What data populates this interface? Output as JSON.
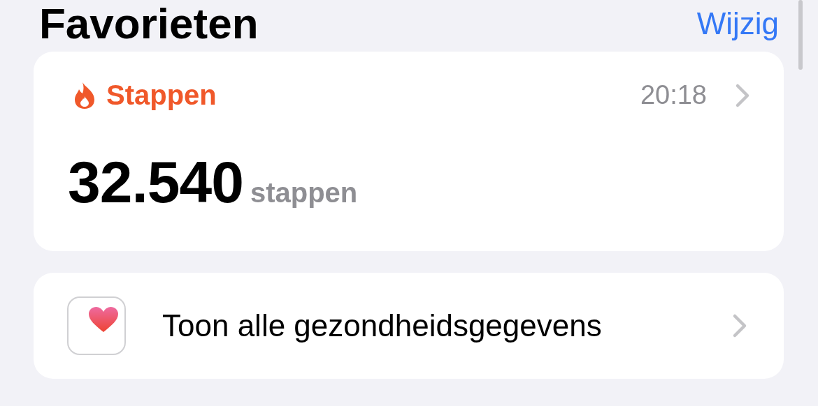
{
  "header": {
    "title": "Favorieten",
    "action": "Wijzig"
  },
  "favorites": [
    {
      "title": "Stappen",
      "time": "20:18",
      "value": "32.540",
      "unit": "stappen",
      "color": "#f0582a"
    }
  ],
  "show_all": {
    "label": "Toon alle gezondheidsgegevens"
  }
}
